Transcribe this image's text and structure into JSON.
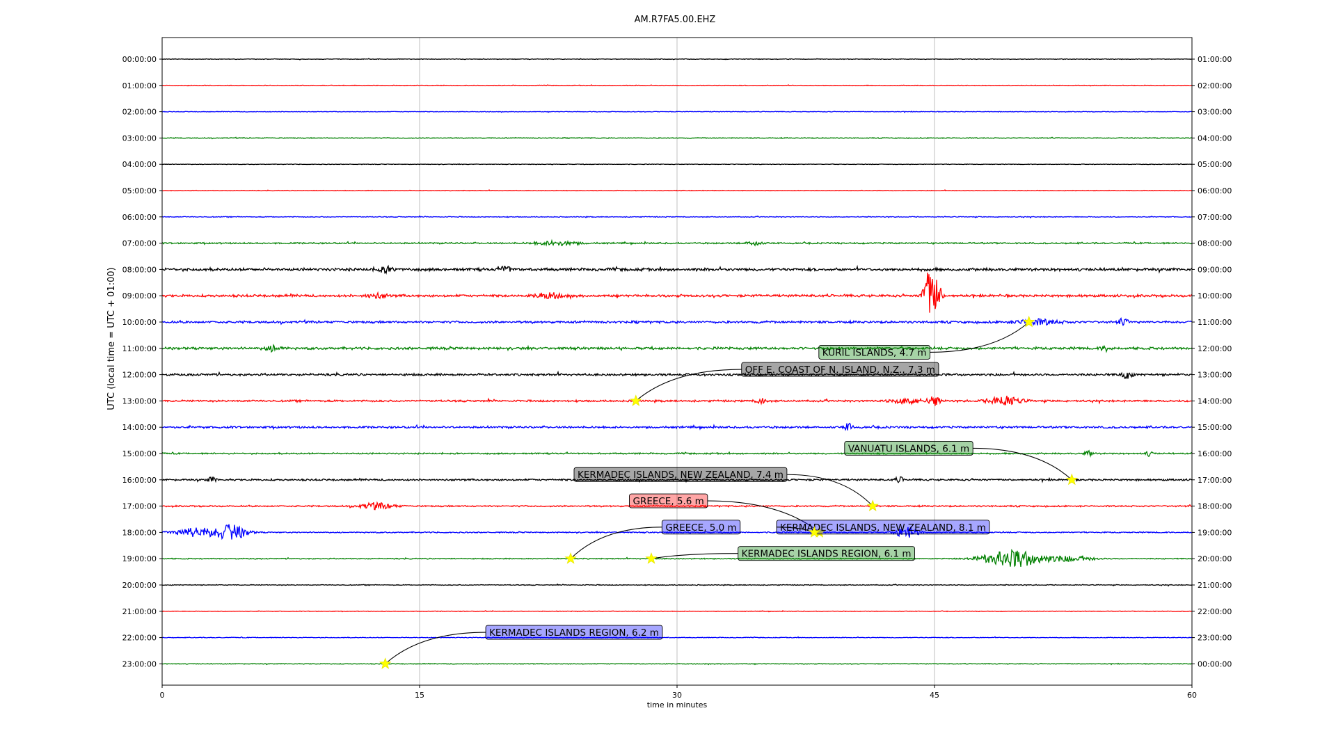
{
  "chart_data": {
    "type": "line",
    "title": "AM.R7FA5.00.EHZ",
    "xlabel": "time in minutes",
    "ylabel": "UTC (local time = UTC + 01:00)",
    "xlim": [
      0,
      60
    ],
    "xticks": [
      0,
      15,
      30,
      45,
      60
    ],
    "grid": "vertical",
    "left_tick_labels": [
      "00:00:00",
      "01:00:00",
      "02:00:00",
      "03:00:00",
      "04:00:00",
      "05:00:00",
      "06:00:00",
      "07:00:00",
      "08:00:00",
      "09:00:00",
      "10:00:00",
      "11:00:00",
      "12:00:00",
      "13:00:00",
      "14:00:00",
      "15:00:00",
      "16:00:00",
      "17:00:00",
      "18:00:00",
      "19:00:00",
      "20:00:00",
      "21:00:00",
      "22:00:00",
      "23:00:00"
    ],
    "right_tick_labels": [
      "01:00:00",
      "02:00:00",
      "03:00:00",
      "04:00:00",
      "05:00:00",
      "06:00:00",
      "07:00:00",
      "08:00:00",
      "09:00:00",
      "10:00:00",
      "11:00:00",
      "12:00:00",
      "13:00:00",
      "14:00:00",
      "15:00:00",
      "16:00:00",
      "17:00:00",
      "18:00:00",
      "19:00:00",
      "20:00:00",
      "21:00:00",
      "22:00:00",
      "23:00:00",
      "00:00:00"
    ],
    "trace_colors": [
      "#000000",
      "#ff0000",
      "#0000ff",
      "#008000"
    ],
    "trace_noise_levels": [
      0.15,
      0.15,
      0.15,
      0.2,
      0.15,
      0.15,
      0.2,
      0.35,
      0.7,
      0.6,
      0.55,
      0.6,
      0.55,
      0.45,
      0.5,
      0.35,
      0.45,
      0.35,
      0.3,
      0.25,
      0.2,
      0.15,
      0.18,
      0.18
    ],
    "bursts": [
      {
        "row": 7,
        "minute": 23,
        "amp": 1.2,
        "dur": 2.5
      },
      {
        "row": 7,
        "minute": 34.5,
        "amp": 1.5,
        "dur": 0.8
      },
      {
        "row": 8,
        "minute": 20,
        "amp": 2.0,
        "dur": 0.6
      },
      {
        "row": 8,
        "minute": 13,
        "amp": 1.4,
        "dur": 1.0
      },
      {
        "row": 9,
        "minute": 44.6,
        "amp": 15,
        "dur": 0.5
      },
      {
        "row": 9,
        "minute": 45.1,
        "amp": 13,
        "dur": 0.5
      },
      {
        "row": 9,
        "minute": 22.5,
        "amp": 1.6,
        "dur": 1.5
      },
      {
        "row": 9,
        "minute": 12.5,
        "amp": 1.3,
        "dur": 1.2
      },
      {
        "row": 10,
        "minute": 51,
        "amp": 1.5,
        "dur": 2.5
      },
      {
        "row": 10,
        "minute": 56,
        "amp": 1.6,
        "dur": 0.6
      },
      {
        "row": 11,
        "minute": 6.5,
        "amp": 1.6,
        "dur": 1.0
      },
      {
        "row": 11,
        "minute": 55,
        "amp": 1.5,
        "dur": 0.6
      },
      {
        "row": 12,
        "minute": 56.2,
        "amp": 2.5,
        "dur": 0.6
      },
      {
        "row": 13,
        "minute": 34.9,
        "amp": 1.8,
        "dur": 0.6
      },
      {
        "row": 13,
        "minute": 43.5,
        "amp": 1.5,
        "dur": 2.0
      },
      {
        "row": 13,
        "minute": 45,
        "amp": 3.0,
        "dur": 0.6
      },
      {
        "row": 13,
        "minute": 49.1,
        "amp": 3.0,
        "dur": 1.8
      },
      {
        "row": 14,
        "minute": 40,
        "amp": 2.2,
        "dur": 0.5
      },
      {
        "row": 15,
        "minute": 54,
        "amp": 1.5,
        "dur": 0.5
      },
      {
        "row": 15,
        "minute": 57.5,
        "amp": 1.3,
        "dur": 0.5
      },
      {
        "row": 16,
        "minute": 2.9,
        "amp": 1.5,
        "dur": 0.5
      },
      {
        "row": 16,
        "minute": 43,
        "amp": 1.4,
        "dur": 0.6
      },
      {
        "row": 17,
        "minute": 12.5,
        "amp": 1.8,
        "dur": 2.0
      },
      {
        "row": 18,
        "minute": 2,
        "amp": 2.6,
        "dur": 2.5
      },
      {
        "row": 18,
        "minute": 4,
        "amp": 4.5,
        "dur": 1.8
      },
      {
        "row": 18,
        "minute": 43.4,
        "amp": 3.5,
        "dur": 1.2
      },
      {
        "row": 19,
        "minute": 49.6,
        "amp": 5.0,
        "dur": 3.5
      },
      {
        "row": 19,
        "minute": 53,
        "amp": 1.5,
        "dur": 2.5
      }
    ],
    "events": [
      {
        "label": "KURIL ISLANDS, 4.7 m",
        "row": 10,
        "minute": 50.5,
        "label_minute": 41.5,
        "label_row": 11.15,
        "color": "#008000"
      },
      {
        "label": "OFF E. COAST OF N. ISLAND, N.Z., 7.3 m",
        "row": 13,
        "minute": 27.6,
        "label_minute": 39.5,
        "label_row": 11.8,
        "color": "#000000"
      },
      {
        "label": "VANUATU ISLANDS, 6.1 m",
        "row": 16,
        "minute": 53.0,
        "label_minute": 43.5,
        "label_row": 14.8,
        "color": "#008000"
      },
      {
        "label": "KERMADEC ISLANDS, NEW ZEALAND, 7.4 m",
        "row": 17,
        "minute": 41.4,
        "label_minute": 30.2,
        "label_row": 15.8,
        "color": "#000000"
      },
      {
        "label": "GREECE, 5.6 m",
        "row": 18,
        "minute": 38.3,
        "label_minute": 29.5,
        "label_row": 16.8,
        "color": "#ff0000"
      },
      {
        "label": "GREECE, 5.0 m",
        "row": 19,
        "minute": 23.8,
        "label_minute": 31.4,
        "label_row": 17.8,
        "color": "#0000ff"
      },
      {
        "label": "KERMADEC ISLANDS, NEW ZEALAND, 8.1 m",
        "row": 18,
        "minute": 38.0,
        "label_minute": 42.0,
        "label_row": 17.8,
        "color": "#0000ff"
      },
      {
        "label": "KERMADEC ISLANDS REGION, 6.1 m",
        "row": 19,
        "minute": 28.5,
        "label_minute": 38.7,
        "label_row": 18.8,
        "color": "#008000"
      },
      {
        "label": "KERMADEC ISLANDS REGION, 6.2 m",
        "row": 20,
        "minute": 25.0,
        "label_minute": 0,
        "label_row": 0,
        "color": "#000000",
        "anchor": "row20"
      },
      {
        "label": "KERMADEC ISLANDS REGION, 6.2 m",
        "row": 23,
        "minute": 13.0,
        "label_minute": 24.0,
        "label_row": 21.8,
        "color": "#0000ff"
      }
    ]
  }
}
